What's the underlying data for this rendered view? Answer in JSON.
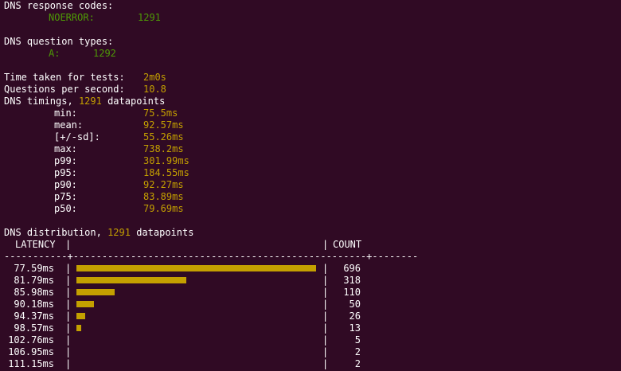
{
  "response_codes": {
    "heading": "DNS response codes:",
    "rows": [
      {
        "label": "NOERROR:",
        "value": "1291"
      }
    ]
  },
  "question_types": {
    "heading": "DNS question types:",
    "rows": [
      {
        "label": "A:",
        "value": "1292"
      }
    ]
  },
  "summary": {
    "time_label": "Time taken for tests:",
    "time_value": "2m0s",
    "qps_label": "Questions per second:",
    "qps_value": "10.8"
  },
  "timings": {
    "heading_prefix": "DNS timings,",
    "count": "1291",
    "heading_suffix": "datapoints",
    "rows": [
      {
        "label": "min:",
        "value": "75.5ms"
      },
      {
        "label": "mean:",
        "value": "92.57ms"
      },
      {
        "label": "[+/-sd]:",
        "value": "55.26ms"
      },
      {
        "label": "max:",
        "value": "738.2ms"
      },
      {
        "label": "p99:",
        "value": "301.99ms"
      },
      {
        "label": "p95:",
        "value": "184.55ms"
      },
      {
        "label": "p90:",
        "value": "92.27ms"
      },
      {
        "label": "p75:",
        "value": "83.89ms"
      },
      {
        "label": "p50:",
        "value": "79.69ms"
      }
    ]
  },
  "distribution": {
    "heading_prefix": "DNS distribution,",
    "count": "1291",
    "heading_suffix": "datapoints",
    "col_latency": "LATENCY",
    "col_count": "COUNT",
    "separator": "-----------+---------------------------------------------------+--------",
    "max_count": 696,
    "rows": [
      {
        "latency": "77.59ms",
        "count": 696
      },
      {
        "latency": "81.79ms",
        "count": 318
      },
      {
        "latency": "85.98ms",
        "count": 110
      },
      {
        "latency": "90.18ms",
        "count": 50
      },
      {
        "latency": "94.37ms",
        "count": 26
      },
      {
        "latency": "98.57ms",
        "count": 13
      },
      {
        "latency": "102.76ms",
        "count": 5
      },
      {
        "latency": "106.95ms",
        "count": 2
      },
      {
        "latency": "111.15ms",
        "count": 2
      }
    ]
  },
  "colors": {
    "background": "#300a24",
    "text": "#ffffff",
    "green": "#4e9a06",
    "gold": "#c4a000"
  }
}
